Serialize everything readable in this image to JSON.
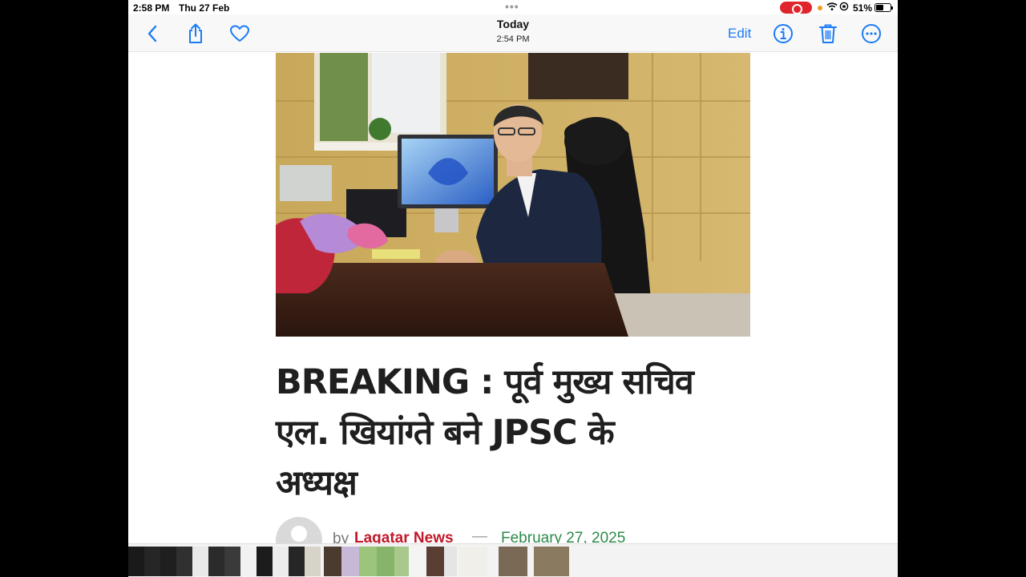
{
  "status_bar": {
    "time": "2:58 PM",
    "date": "Thu 27 Feb",
    "battery": "51%",
    "battery_level": 0.51
  },
  "nav": {
    "title": "Today",
    "subtitle": "2:54 PM",
    "edit_label": "Edit",
    "icons": [
      "chevron-left-icon",
      "share-icon",
      "heart-icon",
      "info-icon",
      "trash-icon",
      "more-icon"
    ],
    "accent_color": "#1a7cf5"
  },
  "article": {
    "headline_line1": "BREAKING : पूर्व मुख्य सचिव",
    "headline_line2": "एल. खियांग्ते बने JPSC के",
    "headline_line3": "अध्यक्ष",
    "by": "by",
    "author": "Lagatar News",
    "separator": "—",
    "date": "February 27, 2025",
    "author_color": "#c0182a",
    "date_color": "#2c8a4a"
  }
}
